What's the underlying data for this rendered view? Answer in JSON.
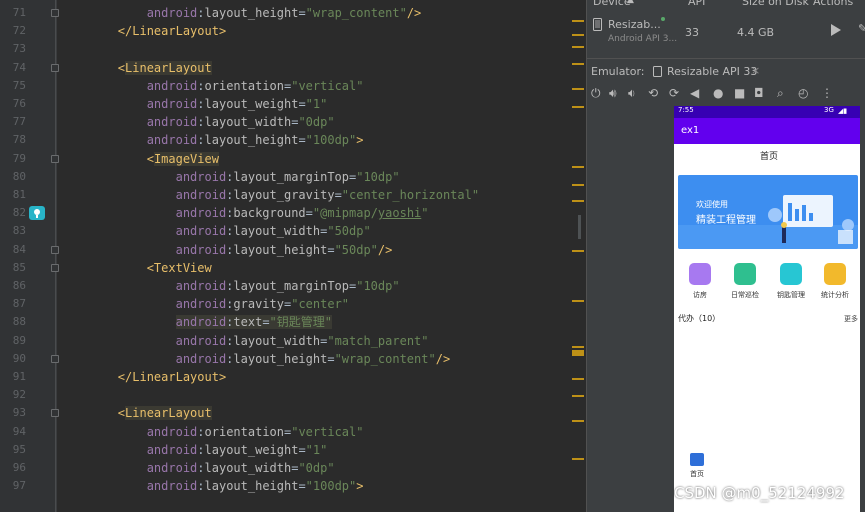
{
  "editor": {
    "line_numbers": [
      "71",
      "72",
      "73",
      "74",
      "75",
      "76",
      "77",
      "78",
      "79",
      "80",
      "81",
      "82",
      "83",
      "84",
      "85",
      "86",
      "87",
      "88",
      "89",
      "90",
      "91",
      "92",
      "93",
      "94",
      "95",
      "96",
      "97"
    ],
    "lines": [
      {
        "indent": "            ",
        "parts": [
          [
            "ns",
            "android"
          ],
          [
            "punct",
            ":"
          ],
          [
            "attr",
            "layout_height"
          ],
          [
            "punct",
            "="
          ],
          [
            "str",
            "\"wrap_content\""
          ],
          [
            "tag",
            "/>"
          ]
        ]
      },
      {
        "indent": "        ",
        "parts": [
          [
            "tag",
            "</LinearLayout>"
          ]
        ]
      },
      {
        "indent": "",
        "parts": []
      },
      {
        "indent": "        ",
        "parts": [
          [
            "tag",
            "<"
          ],
          [
            "tag-hl",
            "LinearLayout"
          ]
        ]
      },
      {
        "indent": "            ",
        "parts": [
          [
            "ns",
            "android"
          ],
          [
            "punct",
            ":"
          ],
          [
            "attr",
            "orientation"
          ],
          [
            "punct",
            "="
          ],
          [
            "str",
            "\"vertical\""
          ]
        ]
      },
      {
        "indent": "            ",
        "parts": [
          [
            "ns",
            "android"
          ],
          [
            "punct",
            ":"
          ],
          [
            "attr",
            "layout_weight"
          ],
          [
            "punct",
            "="
          ],
          [
            "str",
            "\"1\""
          ]
        ]
      },
      {
        "indent": "            ",
        "parts": [
          [
            "ns",
            "android"
          ],
          [
            "punct",
            ":"
          ],
          [
            "attr",
            "layout_width"
          ],
          [
            "punct",
            "="
          ],
          [
            "str",
            "\"0dp\""
          ]
        ]
      },
      {
        "indent": "            ",
        "parts": [
          [
            "ns",
            "android"
          ],
          [
            "punct",
            ":"
          ],
          [
            "attr",
            "layout_height"
          ],
          [
            "punct",
            "="
          ],
          [
            "str",
            "\"100dp\""
          ],
          [
            "tag",
            ">"
          ]
        ]
      },
      {
        "indent": "            ",
        "parts": [
          [
            "tag",
            "<"
          ],
          [
            "tag-hl",
            "ImageView"
          ]
        ]
      },
      {
        "indent": "                ",
        "parts": [
          [
            "ns",
            "android"
          ],
          [
            "punct",
            ":"
          ],
          [
            "attr",
            "layout_marginTop"
          ],
          [
            "punct",
            "="
          ],
          [
            "str",
            "\"10dp\""
          ]
        ]
      },
      {
        "indent": "                ",
        "parts": [
          [
            "ns",
            "android"
          ],
          [
            "punct",
            ":"
          ],
          [
            "attr",
            "layout_gravity"
          ],
          [
            "punct",
            "="
          ],
          [
            "str",
            "\"center_horizontal\""
          ]
        ]
      },
      {
        "indent": "                ",
        "parts": [
          [
            "ns",
            "android"
          ],
          [
            "punct",
            ":"
          ],
          [
            "attr",
            "background"
          ],
          [
            "punct",
            "="
          ],
          [
            "str",
            "\"@mipmap/"
          ],
          [
            "str ul",
            "yaoshi"
          ],
          [
            "str",
            "\""
          ]
        ]
      },
      {
        "indent": "                ",
        "parts": [
          [
            "ns",
            "android"
          ],
          [
            "punct",
            ":"
          ],
          [
            "attr",
            "layout_width"
          ],
          [
            "punct",
            "="
          ],
          [
            "str",
            "\"50dp\""
          ]
        ]
      },
      {
        "indent": "                ",
        "parts": [
          [
            "ns",
            "android"
          ],
          [
            "punct",
            ":"
          ],
          [
            "attr",
            "layout_height"
          ],
          [
            "punct",
            "="
          ],
          [
            "str",
            "\"50dp\""
          ],
          [
            "tag",
            "/>"
          ]
        ]
      },
      {
        "indent": "            ",
        "parts": [
          [
            "tag",
            "<TextView"
          ]
        ]
      },
      {
        "indent": "                ",
        "parts": [
          [
            "ns",
            "android"
          ],
          [
            "punct",
            ":"
          ],
          [
            "attr",
            "layout_marginTop"
          ],
          [
            "punct",
            "="
          ],
          [
            "str",
            "\"10dp\""
          ]
        ]
      },
      {
        "indent": "                ",
        "parts": [
          [
            "ns",
            "android"
          ],
          [
            "punct",
            ":"
          ],
          [
            "attr",
            "gravity"
          ],
          [
            "punct",
            "="
          ],
          [
            "str",
            "\"center\""
          ]
        ]
      },
      {
        "indent": "                ",
        "hl": true,
        "parts": [
          [
            "ns",
            "android"
          ],
          [
            "punct",
            ":"
          ],
          [
            "attr",
            "text"
          ],
          [
            "punct",
            "="
          ],
          [
            "str",
            "\"钥匙管理\""
          ]
        ]
      },
      {
        "indent": "                ",
        "parts": [
          [
            "ns",
            "android"
          ],
          [
            "punct",
            ":"
          ],
          [
            "attr",
            "layout_width"
          ],
          [
            "punct",
            "="
          ],
          [
            "str",
            "\"match_parent\""
          ]
        ]
      },
      {
        "indent": "                ",
        "parts": [
          [
            "ns",
            "android"
          ],
          [
            "punct",
            ":"
          ],
          [
            "attr",
            "layout_height"
          ],
          [
            "punct",
            "="
          ],
          [
            "str",
            "\"wrap_content\""
          ],
          [
            "tag",
            "/>"
          ]
        ]
      },
      {
        "indent": "        ",
        "parts": [
          [
            "tag",
            "</LinearLayout>"
          ]
        ]
      },
      {
        "indent": "",
        "parts": []
      },
      {
        "indent": "        ",
        "parts": [
          [
            "tag",
            "<"
          ],
          [
            "tag-hl",
            "LinearLayout"
          ]
        ]
      },
      {
        "indent": "            ",
        "parts": [
          [
            "ns",
            "android"
          ],
          [
            "punct",
            ":"
          ],
          [
            "attr",
            "orientation"
          ],
          [
            "punct",
            "="
          ],
          [
            "str",
            "\"vertical\""
          ]
        ]
      },
      {
        "indent": "            ",
        "parts": [
          [
            "ns",
            "android"
          ],
          [
            "punct",
            ":"
          ],
          [
            "attr",
            "layout_weight"
          ],
          [
            "punct",
            "="
          ],
          [
            "str",
            "\"1\""
          ]
        ]
      },
      {
        "indent": "            ",
        "parts": [
          [
            "ns",
            "android"
          ],
          [
            "punct",
            ":"
          ],
          [
            "attr",
            "layout_width"
          ],
          [
            "punct",
            "="
          ],
          [
            "str",
            "\"0dp\""
          ]
        ]
      },
      {
        "indent": "            ",
        "parts": [
          [
            "ns",
            "android"
          ],
          [
            "punct",
            ":"
          ],
          [
            "attr",
            "layout_height"
          ],
          [
            "punct",
            "="
          ],
          [
            "str",
            "\"100dp\""
          ],
          [
            "tag",
            ">"
          ]
        ]
      }
    ]
  },
  "device_manager": {
    "col_device": "Device",
    "col_api": "API",
    "col_size": "Size on Disk",
    "col_actions": "Actions",
    "device_name": "Resizab...",
    "device_sub": "Android API 3...",
    "api": "33",
    "size": "4.4 GB"
  },
  "emulator": {
    "label": "Emulator:",
    "tab": "Resizable API 33"
  },
  "phone": {
    "time": "7:55",
    "signal": "3G",
    "app_title": "ex1",
    "page_title": "首页",
    "banner_line1": "欢迎使用",
    "banner_line2": "精装工程管理",
    "quick": [
      "访房",
      "日常巡检",
      "钥匙管理",
      "统计分析"
    ],
    "todo": "代办（10）",
    "more": "更多",
    "nav_home": "首页"
  },
  "watermark": "CSDN @m0_52124992",
  "colors": {
    "accent": "#6200ee",
    "status": "#3700b3",
    "banner": "#3d8ef0"
  }
}
